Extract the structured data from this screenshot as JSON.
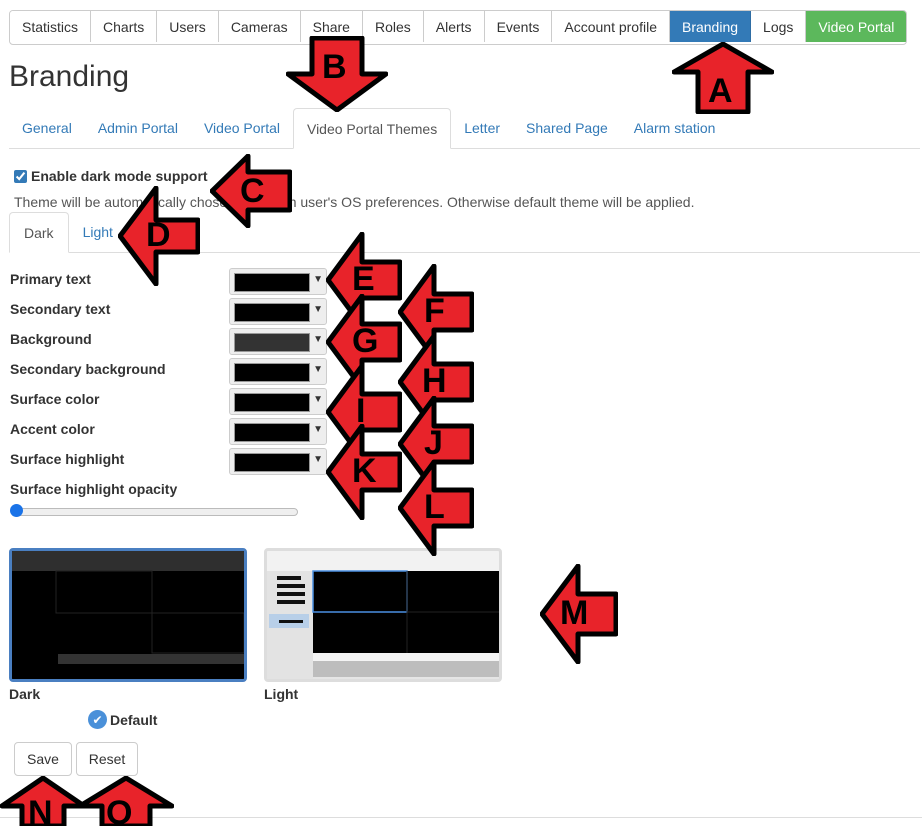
{
  "topnav": {
    "items": [
      "Statistics",
      "Charts",
      "Users",
      "Cameras",
      "Share",
      "Roles",
      "Alerts",
      "Events",
      "Account profile",
      "Branding",
      "Logs",
      "Video Portal"
    ],
    "active": "Branding"
  },
  "page": {
    "title": "Branding"
  },
  "tabs": [
    "General",
    "Admin Portal",
    "Video Portal",
    "Video Portal Themes",
    "Letter",
    "Shared Page",
    "Alarm station"
  ],
  "dark_mode": {
    "label": "Enable dark mode support",
    "checked": true,
    "hint": "Theme will be automatically chosen based on user's OS preferences. Otherwise default theme will be applied."
  },
  "mode_tabs": [
    "Dark",
    "Light"
  ],
  "colors": {
    "rows": [
      {
        "label": "Primary text",
        "value": "#000000"
      },
      {
        "label": "Secondary text",
        "value": "#000000"
      },
      {
        "label": "Background",
        "value": "#333333"
      },
      {
        "label": "Secondary background",
        "value": "#000000"
      },
      {
        "label": "Surface color",
        "value": "#000000"
      },
      {
        "label": "Accent color",
        "value": "#000000"
      },
      {
        "label": "Surface highlight",
        "value": "#000000"
      }
    ],
    "opacity_label": "Surface highlight opacity",
    "opacity_value": 0
  },
  "previews": {
    "dark_label": "Dark",
    "light_label": "Light",
    "default_label": "Default"
  },
  "actions": {
    "save": "Save",
    "reset": "Reset"
  },
  "annotations": [
    "A",
    "B",
    "C",
    "D",
    "E",
    "F",
    "G",
    "H",
    "I",
    "J",
    "K",
    "L",
    "M",
    "N",
    "O"
  ],
  "accent_colors": {
    "primary": "#337ab7",
    "success": "#5cb85c",
    "annotation": "#e8232a"
  }
}
